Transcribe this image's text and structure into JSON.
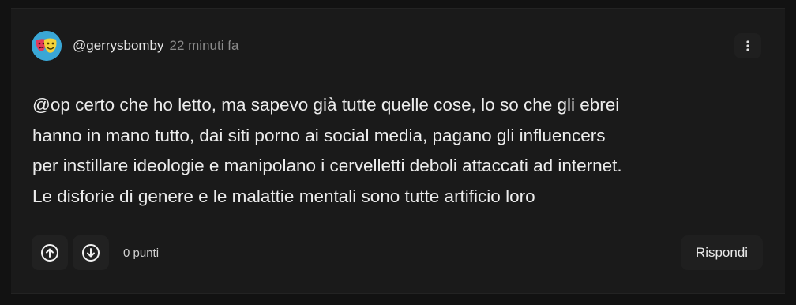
{
  "comment": {
    "username": "@gerrysbomby",
    "timestamp": "22 minuti fa",
    "text": "@op certo che ho letto, ma sapevo già tutte quelle cose, lo so che gli ebrei\nhanno in mano tutto, dai siti porno ai social media, pagano gli influencers\nper instillare ideologie e manipolano i cervelletti deboli attaccati ad internet.\nLe disforie di genere e le malattie mentali sono tutte artificio loro",
    "points": "0 punti"
  },
  "actions": {
    "reply_label": "Rispondi"
  },
  "icons": {
    "menu": "vertical-dots-icon",
    "upvote": "arrow-up-circle-icon",
    "downvote": "arrow-down-circle-icon",
    "avatar": "theater-masks-icon"
  },
  "colors": {
    "background": "#121212",
    "card": "#1a1a1a",
    "avatar_bg": "#3aa7d6"
  }
}
